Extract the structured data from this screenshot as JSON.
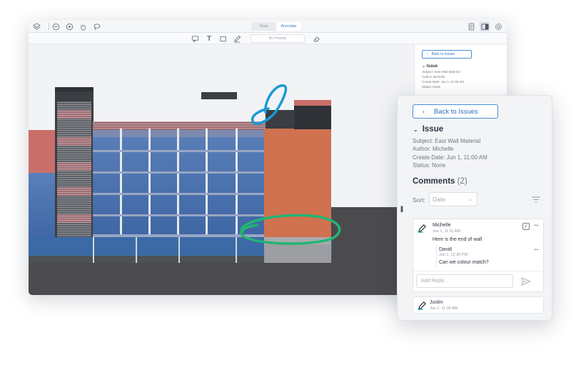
{
  "toolbar": {
    "icons": [
      "layers-icon",
      "zoom-out-icon",
      "zoom-in-icon",
      "pan-hand-icon",
      "lasso-icon"
    ],
    "modes": [
      "View",
      "Annotate"
    ],
    "active_mode": "Annotate",
    "annotation_tools": [
      "comment-icon",
      "text-icon",
      "rectangle-icon",
      "pen-icon"
    ],
    "preset_value": "No Presets",
    "right_icons": [
      "document-icon",
      "panel-icon",
      "settings-icon"
    ]
  },
  "background_panel": {
    "back_label": "Back to Issues",
    "issue_title": "Issue",
    "subject": "Subject: East Wall Material",
    "author": "Author: Michelle",
    "create_date": "Create Date: Jun 1, 11:00 AM",
    "status": "Status: None"
  },
  "issue_panel": {
    "back_label": "Back to Issues",
    "title": "Issue",
    "subject": "Subject: East Wall Material",
    "author": "Author: Michelle",
    "create_date": "Create Date: Jun 1, 11:00 AM",
    "status": "Status: None",
    "comments_label": "Comments",
    "comments_count": "(2)",
    "sort_label": "Sort:",
    "sort_value": "Date"
  },
  "comments": [
    {
      "author": "Michelle",
      "time": "Jun 1, 11:11 AM",
      "text": "Here is the end of wall",
      "replies": [
        {
          "author": "David",
          "time": "Jun 1, 12:30 PM",
          "text": "Can we colour match?"
        }
      ],
      "reply_placeholder": "Add Reply..."
    },
    {
      "author": "Justin",
      "time": "Jun 1, 11:00 AM"
    }
  ],
  "colors": {
    "accent": "#2f6fc2",
    "markup_blue": "#1a9ad6",
    "markup_green": "#22b573",
    "brick": "#d0714f"
  }
}
